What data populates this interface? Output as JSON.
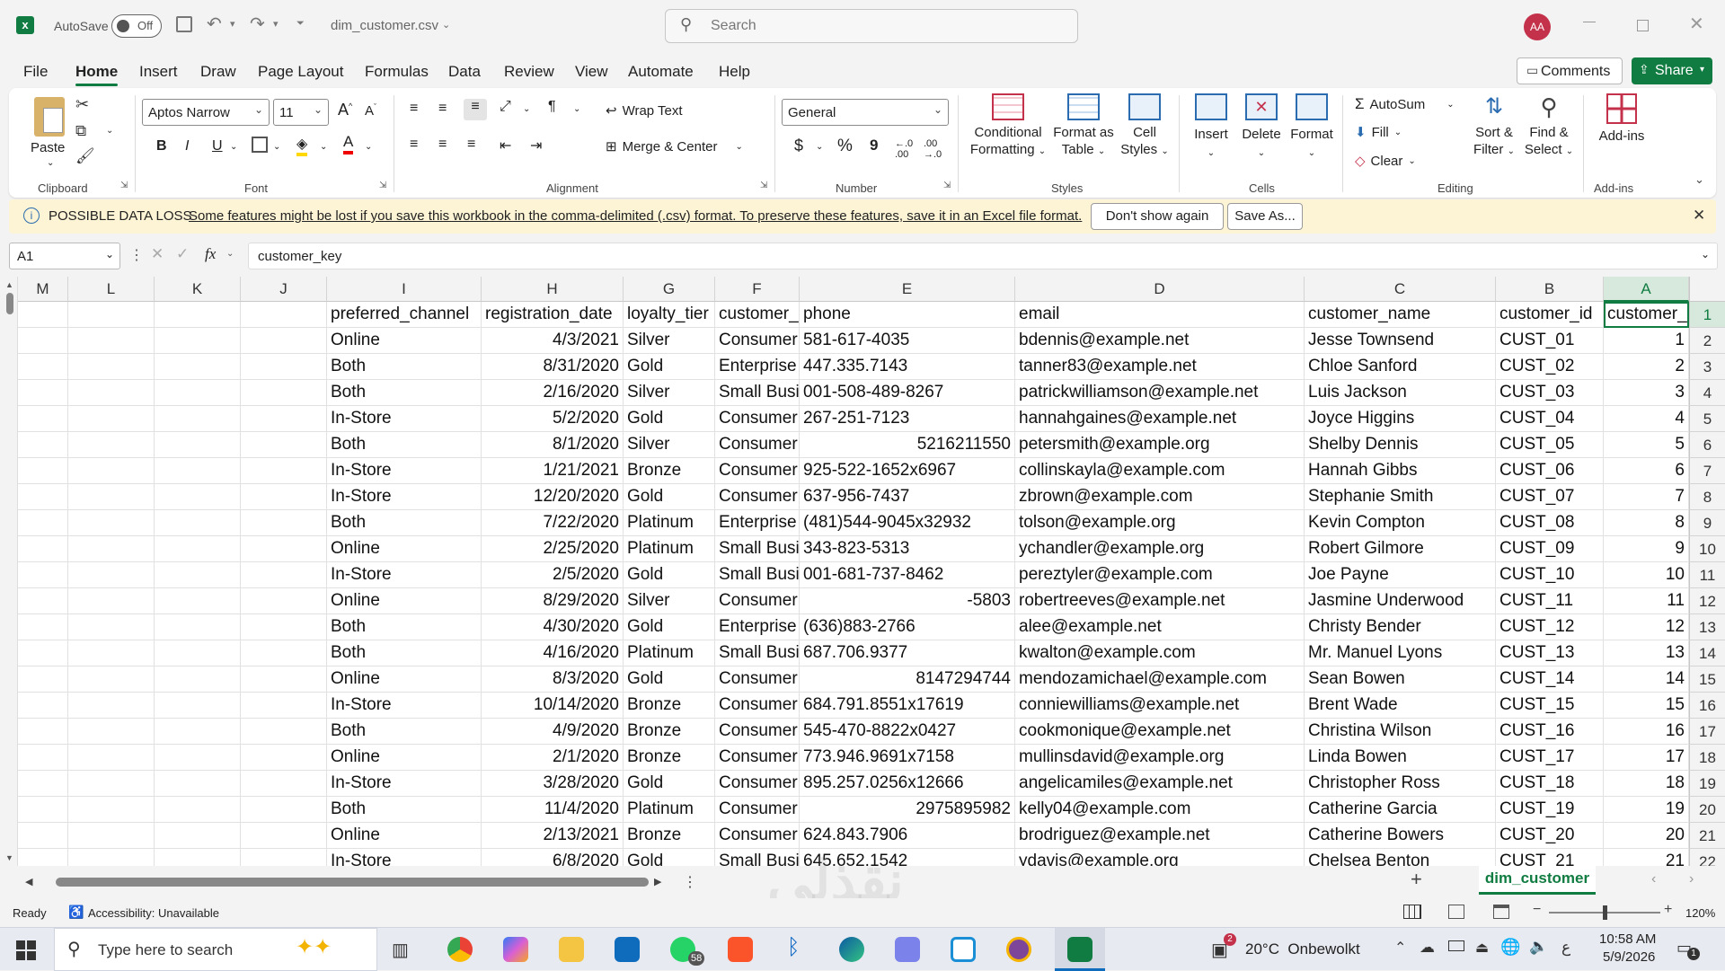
{
  "titlebar": {
    "autosave_label": "AutoSave",
    "autosave_state": "Off",
    "filename": "dim_customer.csv",
    "search_placeholder": "Search",
    "user_initials": "AA"
  },
  "tabs": [
    "File",
    "Home",
    "Insert",
    "Draw",
    "Page Layout",
    "Formulas",
    "Data",
    "Review",
    "View",
    "Automate",
    "Help"
  ],
  "active_tab": "Home",
  "comments_label": "Comments",
  "share_label": "Share",
  "ribbon": {
    "clipboard": {
      "paste": "Paste",
      "label": "Clipboard"
    },
    "font": {
      "name": "Aptos Narrow",
      "size": "11",
      "bold": "B",
      "italic": "I",
      "underline": "U",
      "label": "Font"
    },
    "alignment": {
      "wrap": "Wrap Text",
      "merge": "Merge & Center",
      "label": "Alignment"
    },
    "number": {
      "format": "General",
      "currency": "$",
      "percent": "%",
      "comma": "9",
      "label": "Number"
    },
    "styles": {
      "cond1": "Conditional",
      "cond2": "Formatting",
      "fat1": "Format as",
      "fat2": "Table",
      "cs1": "Cell",
      "cs2": "Styles",
      "label": "Styles"
    },
    "cells": {
      "insert": "Insert",
      "delete": "Delete",
      "format": "Format",
      "label": "Cells"
    },
    "editing": {
      "autosum": "AutoSum",
      "fill": "Fill",
      "clear": "Clear",
      "sort1": "Sort &",
      "sort2": "Filter",
      "find1": "Find &",
      "find2": "Select",
      "label": "Editing"
    },
    "addins": {
      "btn": "Add-ins",
      "label": "Add-ins"
    }
  },
  "warning": {
    "title": "POSSIBLE DATA LOSS",
    "message": "Some features might be lost if you save this workbook in the comma-delimited (.csv) format. To preserve these features, save it in an Excel file format.",
    "dont_show": "Don't show again",
    "save_as": "Save As..."
  },
  "formula": {
    "namebox": "A1",
    "fx": "fx",
    "content": "customer_key"
  },
  "columns": [
    "M",
    "L",
    "K",
    "J",
    "I",
    "H",
    "G",
    "F",
    "E",
    "D",
    "C",
    "B",
    "A"
  ],
  "rows": [
    {
      "n": "1",
      "I": "preferred_channel",
      "H": "registration_date",
      "G": "loyalty_tier",
      "F": "customer_",
      "E": "phone",
      "D": "email",
      "C": "customer_name",
      "B": "customer_id",
      "A": "customer_"
    },
    {
      "n": "2",
      "I": "Online",
      "H": "4/3/2021",
      "G": "Silver",
      "F": "Consumer",
      "E": "581-617-4035",
      "D": "bdennis@example.net",
      "C": "Jesse Townsend",
      "B": "CUST_01",
      "A": "1"
    },
    {
      "n": "3",
      "I": "Both",
      "H": "8/31/2020",
      "G": "Gold",
      "F": "Enterprise",
      "E": "447.335.7143",
      "D": "tanner83@example.net",
      "C": "Chloe Sanford",
      "B": "CUST_02",
      "A": "2"
    },
    {
      "n": "4",
      "I": "Both",
      "H": "2/16/2020",
      "G": "Silver",
      "F": "Small Busi",
      "E": "001-508-489-8267",
      "D": "patrickwilliamson@example.net",
      "C": "Luis Jackson",
      "B": "CUST_03",
      "A": "3"
    },
    {
      "n": "5",
      "I": "In-Store",
      "H": "5/2/2020",
      "G": "Gold",
      "F": "Consumer",
      "E": "267-251-7123",
      "D": "hannahgaines@example.net",
      "C": "Joyce Higgins",
      "B": "CUST_04",
      "A": "4"
    },
    {
      "n": "6",
      "I": "Both",
      "H": "8/1/2020",
      "G": "Silver",
      "F": "Consumer",
      "E": "5216211550",
      "D": "petersmith@example.org",
      "C": "Shelby Dennis",
      "B": "CUST_05",
      "A": "5"
    },
    {
      "n": "7",
      "I": "In-Store",
      "H": "1/21/2021",
      "G": "Bronze",
      "F": "Consumer",
      "E": "925-522-1652x6967",
      "D": "collinskayla@example.com",
      "C": "Hannah Gibbs",
      "B": "CUST_06",
      "A": "6"
    },
    {
      "n": "8",
      "I": "In-Store",
      "H": "12/20/2020",
      "G": "Gold",
      "F": "Consumer",
      "E": "637-956-7437",
      "D": "zbrown@example.com",
      "C": "Stephanie Smith",
      "B": "CUST_07",
      "A": "7"
    },
    {
      "n": "9",
      "I": "Both",
      "H": "7/22/2020",
      "G": "Platinum",
      "F": "Enterprise",
      "E": "(481)544-9045x32932",
      "D": "tolson@example.org",
      "C": "Kevin Compton",
      "B": "CUST_08",
      "A": "8"
    },
    {
      "n": "10",
      "I": "Online",
      "H": "2/25/2020",
      "G": "Platinum",
      "F": "Small Busi",
      "E": "343-823-5313",
      "D": "ychandler@example.org",
      "C": "Robert Gilmore",
      "B": "CUST_09",
      "A": "9"
    },
    {
      "n": "11",
      "I": "In-Store",
      "H": "2/5/2020",
      "G": "Gold",
      "F": "Small Busi",
      "E": "001-681-737-8462",
      "D": "pereztyler@example.com",
      "C": "Joe Payne",
      "B": "CUST_10",
      "A": "10"
    },
    {
      "n": "12",
      "I": "Online",
      "H": "8/29/2020",
      "G": "Silver",
      "F": "Consumer",
      "E": "-5803",
      "D": "robertreeves@example.net",
      "C": "Jasmine Underwood",
      "B": "CUST_11",
      "A": "11"
    },
    {
      "n": "13",
      "I": "Both",
      "H": "4/30/2020",
      "G": "Gold",
      "F": "Enterprise",
      "E": "(636)883-2766",
      "D": "alee@example.net",
      "C": "Christy Bender",
      "B": "CUST_12",
      "A": "12"
    },
    {
      "n": "14",
      "I": "Both",
      "H": "4/16/2020",
      "G": "Platinum",
      "F": "Small Busi",
      "E": "687.706.9377",
      "D": "kwalton@example.com",
      "C": "Mr. Manuel Lyons",
      "B": "CUST_13",
      "A": "13"
    },
    {
      "n": "15",
      "I": "Online",
      "H": "8/3/2020",
      "G": "Gold",
      "F": "Consumer",
      "E": "8147294744",
      "D": "mendozamichael@example.com",
      "C": "Sean Bowen",
      "B": "CUST_14",
      "A": "14"
    },
    {
      "n": "16",
      "I": "In-Store",
      "H": "10/14/2020",
      "G": "Bronze",
      "F": "Consumer",
      "E": "684.791.8551x17619",
      "D": "conniewilliams@example.net",
      "C": "Brent Wade",
      "B": "CUST_15",
      "A": "15"
    },
    {
      "n": "17",
      "I": "Both",
      "H": "4/9/2020",
      "G": "Bronze",
      "F": "Consumer",
      "E": "545-470-8822x0427",
      "D": "cookmonique@example.net",
      "C": "Christina Wilson",
      "B": "CUST_16",
      "A": "16"
    },
    {
      "n": "18",
      "I": "Online",
      "H": "2/1/2020",
      "G": "Bronze",
      "F": "Consumer",
      "E": "773.946.9691x7158",
      "D": "mullinsdavid@example.org",
      "C": "Linda Bowen",
      "B": "CUST_17",
      "A": "17"
    },
    {
      "n": "19",
      "I": "In-Store",
      "H": "3/28/2020",
      "G": "Gold",
      "F": "Consumer",
      "E": "895.257.0256x12666",
      "D": "angelicamiles@example.net",
      "C": "Christopher Ross",
      "B": "CUST_18",
      "A": "18"
    },
    {
      "n": "20",
      "I": "Both",
      "H": "11/4/2020",
      "G": "Platinum",
      "F": "Consumer",
      "E": "2975895982",
      "D": "kelly04@example.com",
      "C": "Catherine Garcia",
      "B": "CUST_19",
      "A": "19"
    },
    {
      "n": "21",
      "I": "Online",
      "H": "2/13/2021",
      "G": "Bronze",
      "F": "Consumer",
      "E": "624.843.7906",
      "D": "brodriguez@example.net",
      "C": "Catherine Bowers",
      "B": "CUST_20",
      "A": "20"
    },
    {
      "n": "22",
      "I": "In-Store",
      "H": "6/8/2020",
      "G": "Gold",
      "F": "Small Busi",
      "E": "645.652.1542",
      "D": "ydavis@example.org",
      "C": "Chelsea Benton",
      "B": "CUST_21",
      "A": "21"
    }
  ],
  "sheet_tab": "dim_customer",
  "status": {
    "ready": "Ready",
    "accessibility": "Accessibility: Unavailable",
    "zoom": "120%"
  },
  "taskbar": {
    "search_placeholder": "Type here to search",
    "whatsapp_badge": "58",
    "weather_badge": "2",
    "weather": "20°C  Onbewolkt",
    "lang": "ع",
    "time": "10:58 AM",
    "date": "5/9/2026",
    "notif_badge": "1"
  },
  "watermark": "نقذلي",
  "colors": {
    "excel_green": "#107c41",
    "warning_bg": "#fcf4d4",
    "avatar": "#c4314b"
  }
}
